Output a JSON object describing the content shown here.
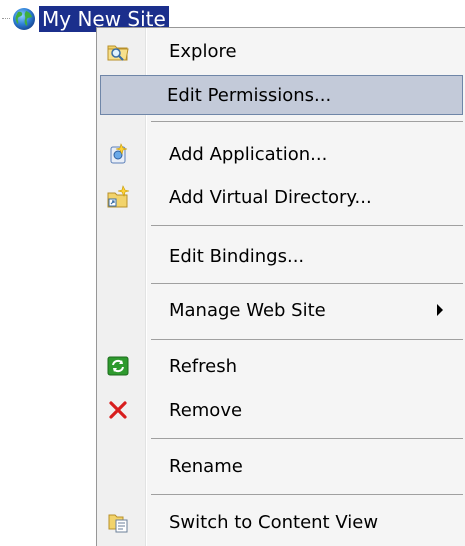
{
  "tree": {
    "node_label": "My New Site",
    "node_icon": "globe-icon"
  },
  "menu": {
    "items": [
      {
        "id": "explore",
        "label": "Explore",
        "icon": "folder-search-icon"
      },
      {
        "id": "edit-permissions",
        "label": "Edit Permissions...",
        "icon": "",
        "highlighted": true
      },
      {
        "id": "add-application",
        "label": "Add Application...",
        "icon": "add-application-icon"
      },
      {
        "id": "add-virtual-directory",
        "label": "Add Virtual Directory...",
        "icon": "add-virtual-directory-icon"
      },
      {
        "id": "edit-bindings",
        "label": "Edit Bindings...",
        "icon": ""
      },
      {
        "id": "manage-web-site",
        "label": "Manage Web Site",
        "icon": "",
        "submenu": true
      },
      {
        "id": "refresh",
        "label": "Refresh",
        "icon": "refresh-icon"
      },
      {
        "id": "remove",
        "label": "Remove",
        "icon": "remove-x-icon"
      },
      {
        "id": "rename",
        "label": "Rename",
        "icon": ""
      },
      {
        "id": "switch-content-view",
        "label": "Switch to Content View",
        "icon": "content-view-icon"
      }
    ]
  },
  "colors": {
    "selection_bg": "#1b2f8c",
    "highlight_bg": "#c3cad9",
    "highlight_border": "#6f86a8",
    "menu_bg": "#f5f5f5",
    "remove_red": "#d81e1e",
    "refresh_green": "#2e9a2e"
  }
}
